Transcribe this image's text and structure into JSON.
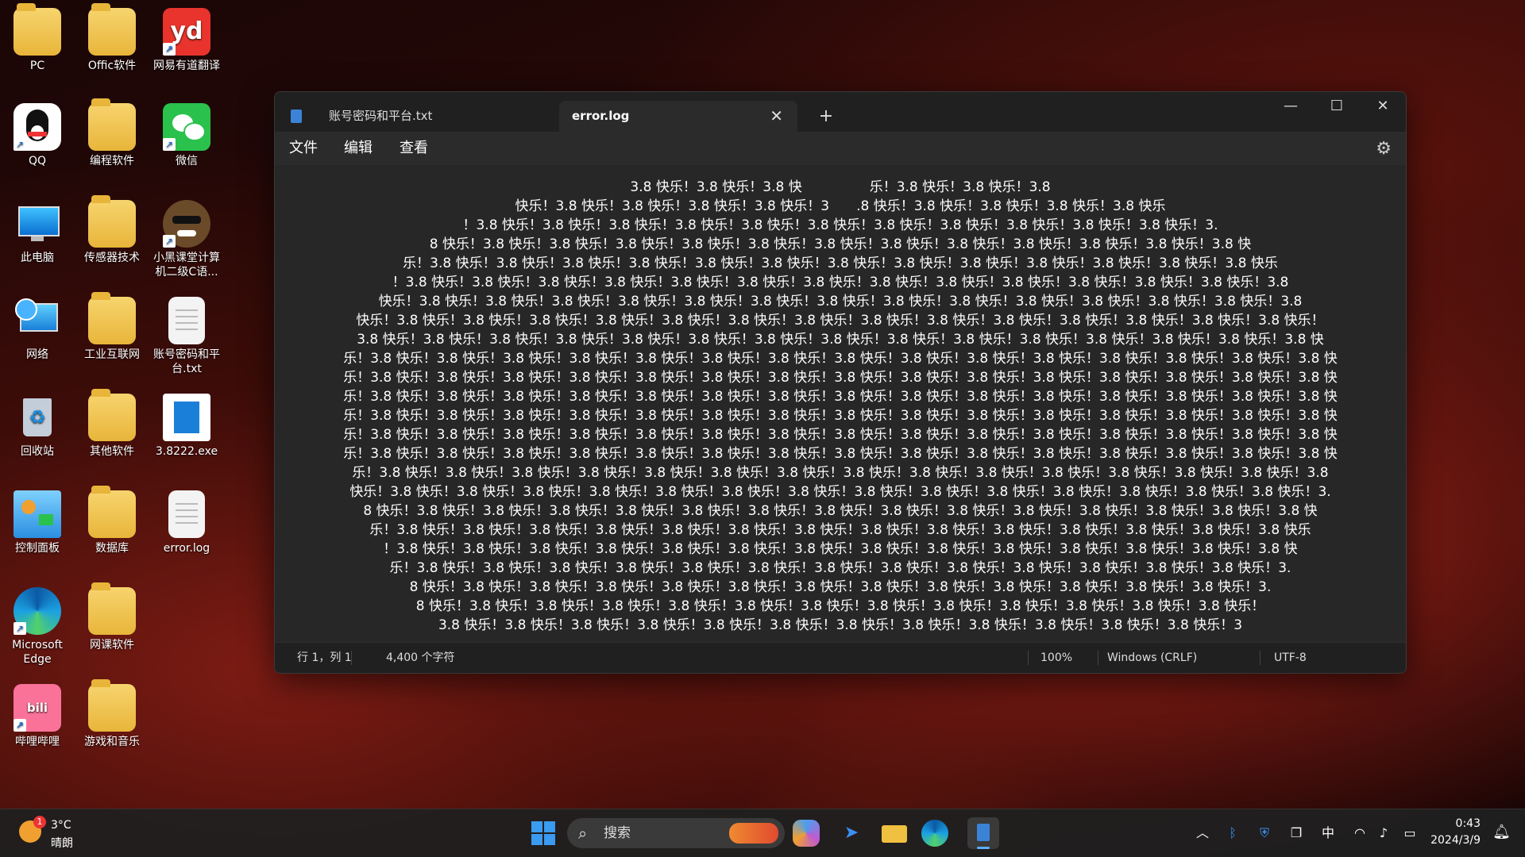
{
  "desktop": {
    "icons": [
      {
        "label": "PC"
      },
      {
        "label": "Offic软件"
      },
      {
        "label": "网易有道翻译"
      },
      {
        "label": "QQ"
      },
      {
        "label": "编程软件"
      },
      {
        "label": "微信"
      },
      {
        "label": "此电脑"
      },
      {
        "label": "传感器技术"
      },
      {
        "label": "小黑课堂计算机二级C语..."
      },
      {
        "label": "网络"
      },
      {
        "label": "工业互联网"
      },
      {
        "label": "账号密码和平台.txt"
      },
      {
        "label": "回收站"
      },
      {
        "label": "其他软件"
      },
      {
        "label": "3.8222.exe"
      },
      {
        "label": "控制面板"
      },
      {
        "label": "数据库"
      },
      {
        "label": "error.log"
      },
      {
        "label": "Microsoft Edge"
      },
      {
        "label": "网课软件"
      },
      {
        "label": "哔哩哔哩"
      },
      {
        "label": "游戏和音乐"
      }
    ]
  },
  "window": {
    "tabs": [
      {
        "label": "账号密码和平台.txt"
      },
      {
        "label": "error.log"
      }
    ],
    "menu": {
      "file": "文件",
      "edit": "编辑",
      "view": "查看"
    },
    "editor_lines": [
      "3.8 快乐！3.8 快乐！3.8 快　　　　　乐！3.8 快乐！3.8 快乐！3.8",
      "快乐！3.8 快乐！3.8 快乐！3.8 快乐！3.8 快乐！3　　.8 快乐！3.8 快乐！3.8 快乐！3.8 快乐！3.8 快乐",
      "！3.8 快乐！3.8 快乐！3.8 快乐！3.8 快乐！3.8 快乐！3.8 快乐！3.8 快乐！3.8 快乐！3.8 快乐！3.8 快乐！3.8 快乐！3.",
      "8 快乐！3.8 快乐！3.8 快乐！3.8 快乐！3.8 快乐！3.8 快乐！3.8 快乐！3.8 快乐！3.8 快乐！3.8 快乐！3.8 快乐！3.8 快乐！3.8 快",
      "乐！3.8 快乐！3.8 快乐！3.8 快乐！3.8 快乐！3.8 快乐！3.8 快乐！3.8 快乐！3.8 快乐！3.8 快乐！3.8 快乐！3.8 快乐！3.8 快乐！3.8 快乐",
      "！3.8 快乐！3.8 快乐！3.8 快乐！3.8 快乐！3.8 快乐！3.8 快乐！3.8 快乐！3.8 快乐！3.8 快乐！3.8 快乐！3.8 快乐！3.8 快乐！3.8 快乐！3.8",
      "快乐！3.8 快乐！3.8 快乐！3.8 快乐！3.8 快乐！3.8 快乐！3.8 快乐！3.8 快乐！3.8 快乐！3.8 快乐！3.8 快乐！3.8 快乐！3.8 快乐！3.8 快乐！3.8",
      "快乐！3.8 快乐！3.8 快乐！3.8 快乐！3.8 快乐！3.8 快乐！3.8 快乐！3.8 快乐！3.8 快乐！3.8 快乐！3.8 快乐！3.8 快乐！3.8 快乐！3.8 快乐！3.8 快乐！",
      "3.8 快乐！3.8 快乐！3.8 快乐！3.8 快乐！3.8 快乐！3.8 快乐！3.8 快乐！3.8 快乐！3.8 快乐！3.8 快乐！3.8 快乐！3.8 快乐！3.8 快乐！3.8 快乐！3.8 快",
      "乐！3.8 快乐！3.8 快乐！3.8 快乐！3.8 快乐！3.8 快乐！3.8 快乐！3.8 快乐！3.8 快乐！3.8 快乐！3.8 快乐！3.8 快乐！3.8 快乐！3.8 快乐！3.8 快乐！3.8 快",
      "乐！3.8 快乐！3.8 快乐！3.8 快乐！3.8 快乐！3.8 快乐！3.8 快乐！3.8 快乐！3.8 快乐！3.8 快乐！3.8 快乐！3.8 快乐！3.8 快乐！3.8 快乐！3.8 快乐！3.8 快",
      "乐！3.8 快乐！3.8 快乐！3.8 快乐！3.8 快乐！3.8 快乐！3.8 快乐！3.8 快乐！3.8 快乐！3.8 快乐！3.8 快乐！3.8 快乐！3.8 快乐！3.8 快乐！3.8 快乐！3.8 快",
      "乐！3.8 快乐！3.8 快乐！3.8 快乐！3.8 快乐！3.8 快乐！3.8 快乐！3.8 快乐！3.8 快乐！3.8 快乐！3.8 快乐！3.8 快乐！3.8 快乐！3.8 快乐！3.8 快乐！3.8 快",
      "乐！3.8 快乐！3.8 快乐！3.8 快乐！3.8 快乐！3.8 快乐！3.8 快乐！3.8 快乐！3.8 快乐！3.8 快乐！3.8 快乐！3.8 快乐！3.8 快乐！3.8 快乐！3.8 快乐！3.8 快",
      "乐！3.8 快乐！3.8 快乐！3.8 快乐！3.8 快乐！3.8 快乐！3.8 快乐！3.8 快乐！3.8 快乐！3.8 快乐！3.8 快乐！3.8 快乐！3.8 快乐！3.8 快乐！3.8 快乐！3.8 快",
      "乐！3.8 快乐！3.8 快乐！3.8 快乐！3.8 快乐！3.8 快乐！3.8 快乐！3.8 快乐！3.8 快乐！3.8 快乐！3.8 快乐！3.8 快乐！3.8 快乐！3.8 快乐！3.8 快乐！3.8",
      "快乐！3.8 快乐！3.8 快乐！3.8 快乐！3.8 快乐！3.8 快乐！3.8 快乐！3.8 快乐！3.8 快乐！3.8 快乐！3.8 快乐！3.8 快乐！3.8 快乐！3.8 快乐！3.8 快乐！3.",
      "8 快乐！3.8 快乐！3.8 快乐！3.8 快乐！3.8 快乐！3.8 快乐！3.8 快乐！3.8 快乐！3.8 快乐！3.8 快乐！3.8 快乐！3.8 快乐！3.8 快乐！3.8 快乐！3.8 快",
      "乐！3.8 快乐！3.8 快乐！3.8 快乐！3.8 快乐！3.8 快乐！3.8 快乐！3.8 快乐！3.8 快乐！3.8 快乐！3.8 快乐！3.8 快乐！3.8 快乐！3.8 快乐！3.8 快乐",
      "！3.8 快乐！3.8 快乐！3.8 快乐！3.8 快乐！3.8 快乐！3.8 快乐！3.8 快乐！3.8 快乐！3.8 快乐！3.8 快乐！3.8 快乐！3.8 快乐！3.8 快乐！3.8 快",
      "乐！3.8 快乐！3.8 快乐！3.8 快乐！3.8 快乐！3.8 快乐！3.8 快乐！3.8 快乐！3.8 快乐！3.8 快乐！3.8 快乐！3.8 快乐！3.8 快乐！3.8 快乐！3.",
      "8 快乐！3.8 快乐！3.8 快乐！3.8 快乐！3.8 快乐！3.8 快乐！3.8 快乐！3.8 快乐！3.8 快乐！3.8 快乐！3.8 快乐！3.8 快乐！3.8 快乐！3.",
      "8 快乐！3.8 快乐！3.8 快乐！3.8 快乐！3.8 快乐！3.8 快乐！3.8 快乐！3.8 快乐！3.8 快乐！3.8 快乐！3.8 快乐！3.8 快乐！3.8 快乐！",
      "3.8 快乐！3.8 快乐！3.8 快乐！3.8 快乐！3.8 快乐！3.8 快乐！3.8 快乐！3.8 快乐！3.8 快乐！3.8 快乐！3.8 快乐！3.8 快乐！3"
    ],
    "status": {
      "position": "行 1，列 1",
      "chars": "4,400 个字符",
      "zoom": "100%",
      "line_ending": "Windows (CRLF)",
      "encoding": "UTF-8"
    }
  },
  "taskbar": {
    "weather_temp": "3°C",
    "weather_cond": "晴朗",
    "weather_badge": "1",
    "search_label": "搜索",
    "ime": "中",
    "time": "0:43",
    "date": "2024/3/9"
  }
}
